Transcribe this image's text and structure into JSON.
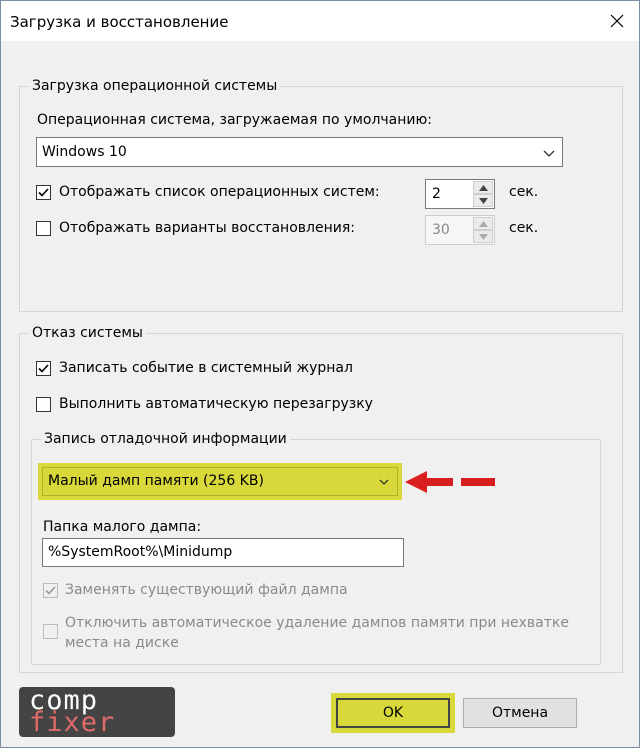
{
  "window": {
    "title": "Загрузка и восстановление"
  },
  "startup": {
    "group_label": "Загрузка операционной системы",
    "default_os_label": "Операционная система, загружаемая по умолчанию:",
    "default_os_value": "Windows 10",
    "show_list_label": "Отображать список операционных систем:",
    "show_list_checked": true,
    "show_list_time": "2",
    "show_recovery_label": "Отображать варианты восстановления:",
    "show_recovery_checked": false,
    "show_recovery_time": "30",
    "unit": "сек."
  },
  "failure": {
    "group_label": "Отказ системы",
    "write_event_label": "Записать событие в системный журнал",
    "write_event_checked": true,
    "auto_restart_label": "Выполнить автоматическую перезагрузку",
    "auto_restart_checked": false,
    "debug_group_label": "Запись отладочной информации",
    "dump_type_value": "Малый дамп памяти (256 KB)",
    "dump_folder_label": "Папка малого дампа:",
    "dump_folder_value": "%SystemRoot%\\Minidump",
    "overwrite_label": "Заменять существующий файл дампа",
    "overwrite_checked": true,
    "disable_autodelete_label_1": "Отключить автоматическое удаление дампов памяти при нехватке",
    "disable_autodelete_label_2": "места на диске",
    "disable_autodelete_checked": false
  },
  "buttons": {
    "ok": "OK",
    "cancel": "Отмена"
  },
  "watermark": {
    "line1": "comp",
    "line2": "fixer"
  },
  "colors": {
    "highlight": "#d8d83a",
    "arrow": "#d81e1e",
    "accent": "#0078d7"
  }
}
